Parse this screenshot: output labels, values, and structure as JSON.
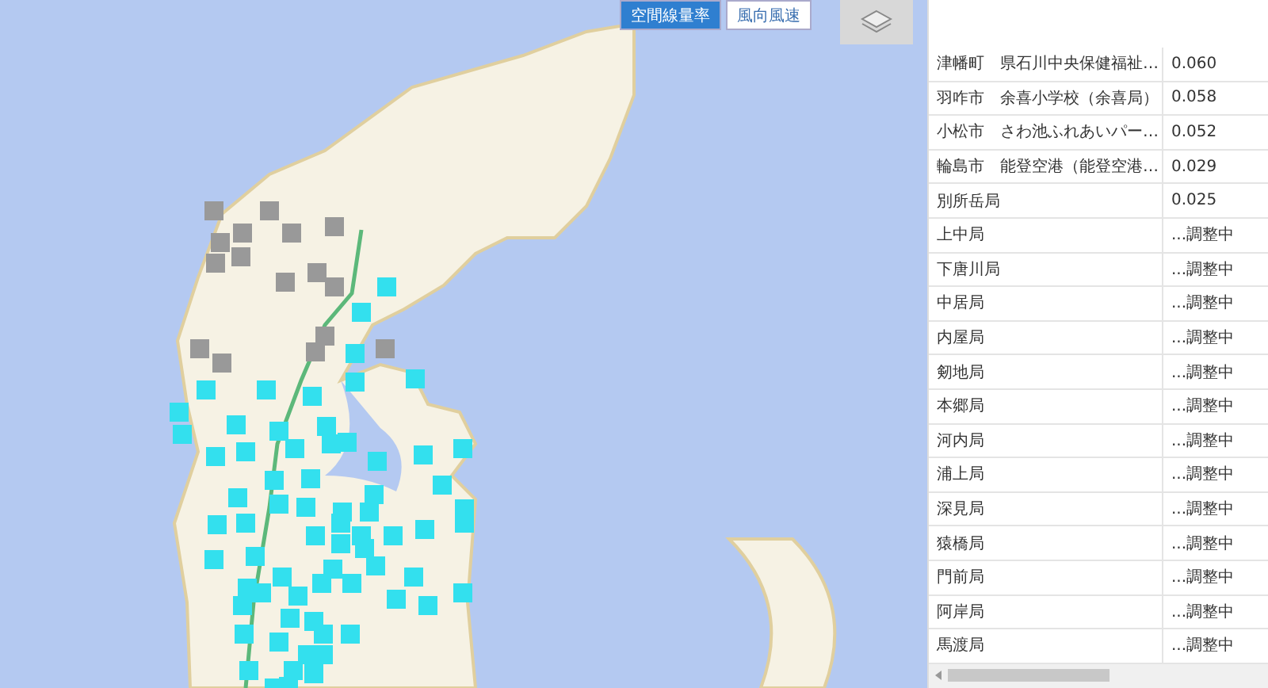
{
  "layer_tabs": [
    {
      "label": "空間線量率",
      "selected": true
    },
    {
      "label": "風向風速",
      "selected": false
    }
  ],
  "table": {
    "rows": [
      {
        "station": "津幡町　県石川中央保健福祉…",
        "value": "0.060"
      },
      {
        "station": "羽咋市　余喜小学校（余喜局）",
        "value": "0.058"
      },
      {
        "station": "小松市　さわ池ふれあいパー…",
        "value": "0.052"
      },
      {
        "station": "輪島市　能登空港（能登空港…",
        "value": "0.029"
      },
      {
        "station": "別所岳局",
        "value": "0.025"
      },
      {
        "station": "上中局",
        "value": "...調整中"
      },
      {
        "station": "下唐川局",
        "value": "...調整中"
      },
      {
        "station": "中居局",
        "value": "...調整中"
      },
      {
        "station": "内屋局",
        "value": "...調整中"
      },
      {
        "station": "剱地局",
        "value": "...調整中"
      },
      {
        "station": "本郷局",
        "value": "...調整中"
      },
      {
        "station": "河内局",
        "value": "...調整中"
      },
      {
        "station": "浦上局",
        "value": "...調整中"
      },
      {
        "station": "深見局",
        "value": "...調整中"
      },
      {
        "station": "猿橋局",
        "value": "...調整中"
      },
      {
        "station": "門前局",
        "value": "...調整中"
      },
      {
        "station": "阿岸局",
        "value": "...調整中"
      },
      {
        "station": "馬渡局",
        "value": "...調整中"
      }
    ]
  }
}
